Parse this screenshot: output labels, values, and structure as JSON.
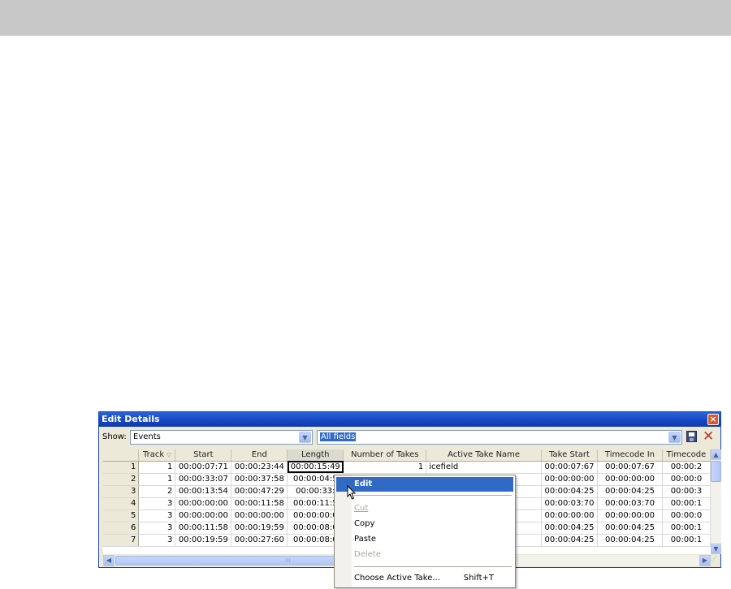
{
  "window": {
    "title": "Edit Details"
  },
  "toolbar": {
    "show_label": "Show:",
    "show_value": "Events",
    "fields_value": "All fields",
    "save_icon": "save-icon",
    "delete_icon": "delete-icon"
  },
  "columns": [
    "",
    "Track",
    "Start",
    "End",
    "Length",
    "Number of Takes",
    "Active Take Name",
    "Take Start",
    "Timecode In",
    "Timecode"
  ],
  "rows": [
    [
      "1",
      "1",
      "00:00:07:71",
      "00:00:23:44",
      "00:00:15:49",
      "1",
      "icefield",
      "00:00:07:67",
      "00:00:07:67",
      "00:00:2"
    ],
    [
      "2",
      "1",
      "00:00:33:07",
      "00:00:37:58",
      "00:00:04:5",
      "",
      "",
      "00:00:00:00",
      "00:00:00:00",
      "00:00:0"
    ],
    [
      "3",
      "2",
      "00:00:13:54",
      "00:00:47:29",
      "00:00:33:",
      "",
      "",
      "00:00:04:25",
      "00:00:04:25",
      "00:00:3"
    ],
    [
      "4",
      "3",
      "00:00:00:00",
      "00:00:11:58",
      "00:00:11:5",
      "",
      "",
      "00:00:03:70",
      "00:00:03:70",
      "00:00:1"
    ],
    [
      "5",
      "3",
      "00:00:00:00",
      "00:00:00:00",
      "00:00:00:0",
      "",
      "",
      "00:00:00:00",
      "00:00:00:00",
      "00:00:0"
    ],
    [
      "6",
      "3",
      "00:00:11:58",
      "00:00:19:59",
      "00:00:08:0",
      "",
      "",
      "00:00:04:25",
      "00:00:04:25",
      "00:00:1"
    ],
    [
      "7",
      "3",
      "00:00:19:59",
      "00:00:27:60",
      "00:00:08:0",
      "",
      "",
      "00:00:04:25",
      "00:00:04:25",
      "00:00:1"
    ]
  ],
  "context_menu": {
    "edit": "Edit",
    "cut": "Cut",
    "copy": "Copy",
    "paste": "Paste",
    "delete": "Delete",
    "choose_active_take": "Choose Active Take...",
    "choose_active_take_shortcut": "Shift+T"
  },
  "colors": {
    "titlebar": "#1447c2",
    "highlight": "#316ac5",
    "window_bg": "#ece9d8"
  }
}
